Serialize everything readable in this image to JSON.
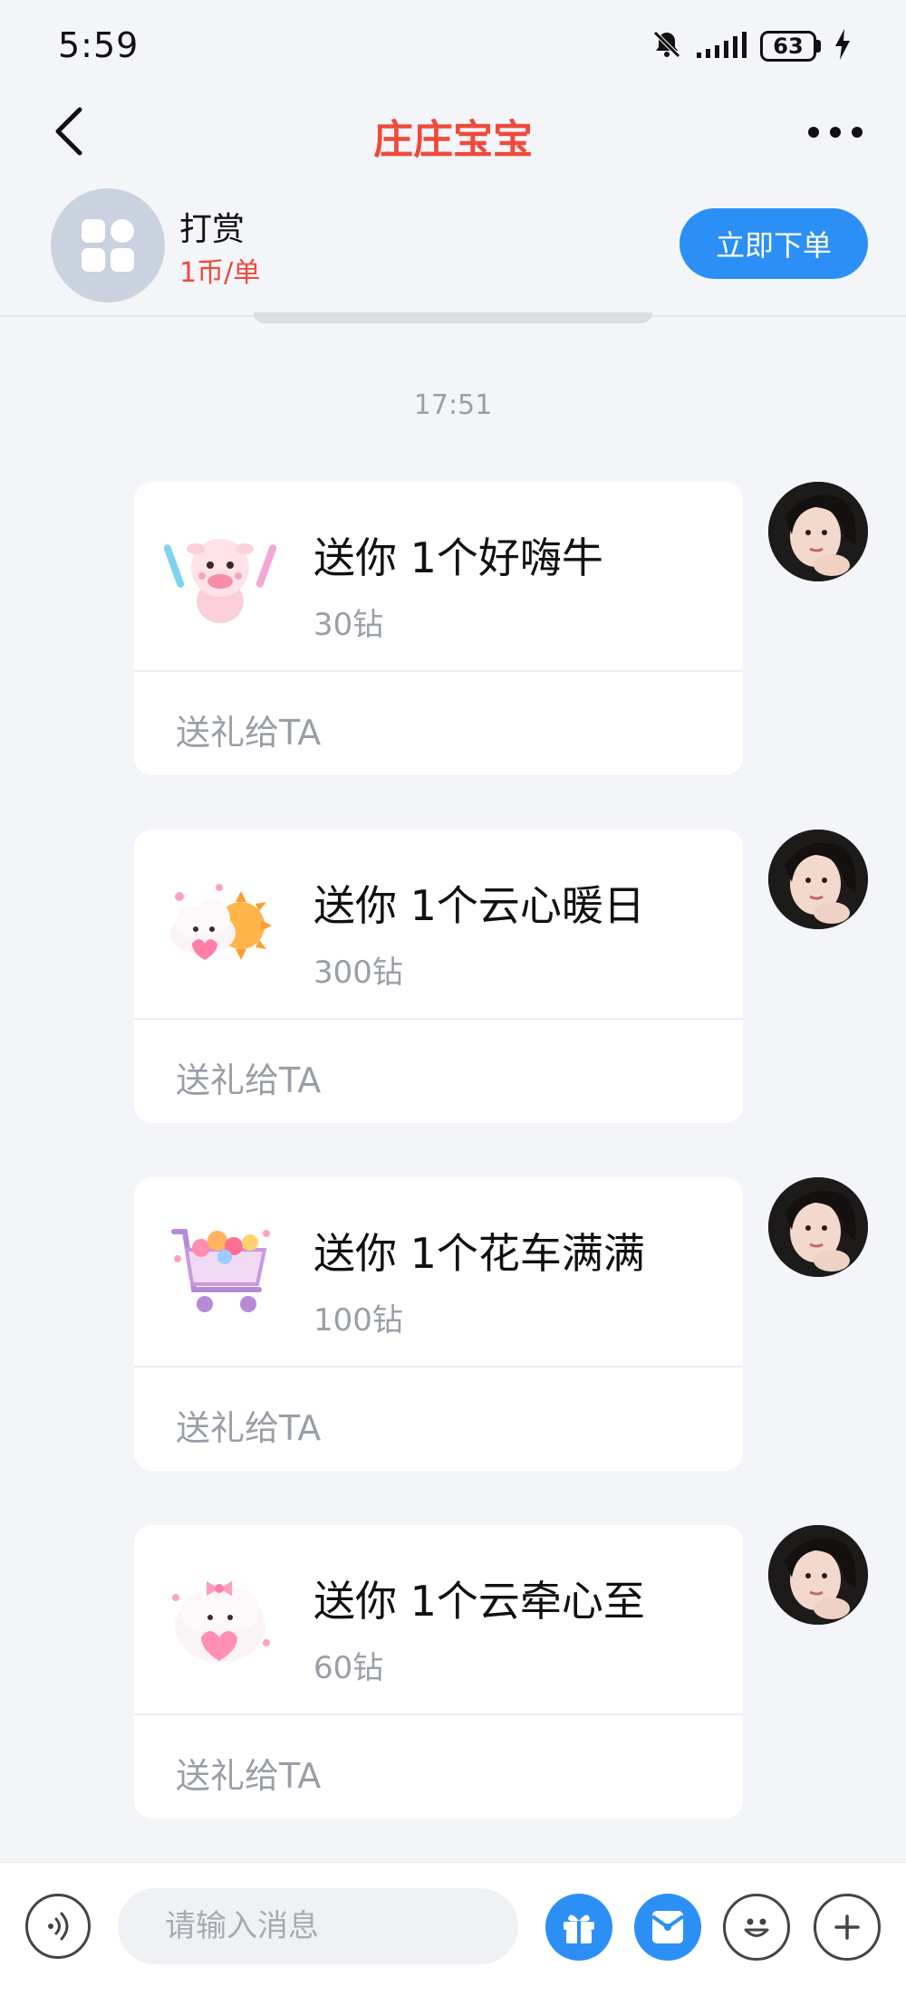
{
  "status_bar": {
    "time": "5:59",
    "battery": "63"
  },
  "header": {
    "title": "庄庄宝宝"
  },
  "order": {
    "name": "打赏",
    "price": "1币/单",
    "button_label": "立即下单"
  },
  "chat": {
    "timestamp": "17:51",
    "messages": [
      {
        "title": "送你 1个好嗨牛",
        "price": "30钻",
        "action": "送礼给TA",
        "gift_icon": "cow-gift-icon"
      },
      {
        "title": "送你 1个云心暖日",
        "price": "300钻",
        "action": "送礼给TA",
        "gift_icon": "cloud-sun-gift-icon"
      },
      {
        "title": "送你 1个花车满满",
        "price": "100钻",
        "action": "送礼给TA",
        "gift_icon": "flower-cart-gift-icon"
      },
      {
        "title": "送你 1个云牵心至",
        "price": "60钻",
        "action": "送礼给TA",
        "gift_icon": "cloud-heart-gift-icon"
      }
    ]
  },
  "input_bar": {
    "placeholder": "请输入消息"
  },
  "colors": {
    "accent": "#2b8ff6",
    "title_red": "#f0493a",
    "background": "#f3f5f9"
  }
}
